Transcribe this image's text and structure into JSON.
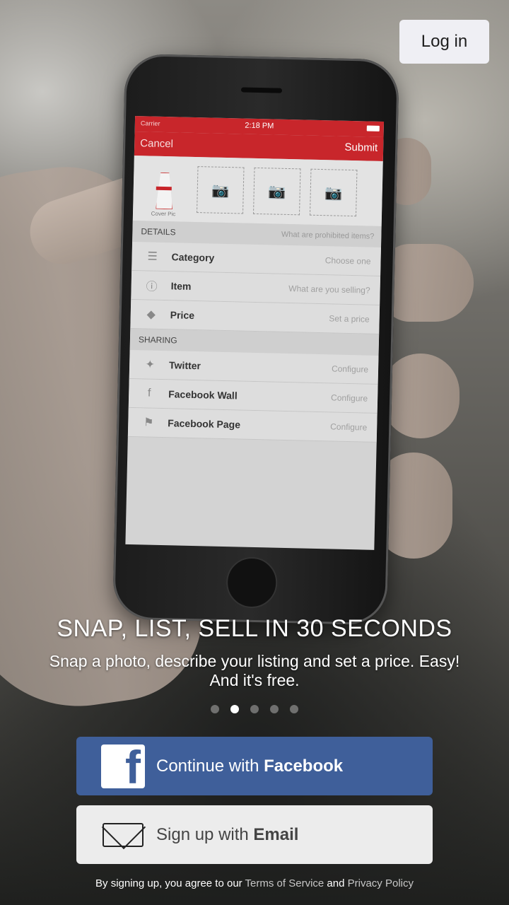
{
  "header": {
    "login_label": "Log in"
  },
  "phone_screen": {
    "status": {
      "carrier": "Carrier",
      "time": "2:18 PM"
    },
    "nav": {
      "cancel": "Cancel",
      "submit": "Submit"
    },
    "cover_label": "Cover Pic",
    "details": {
      "title": "DETAILS",
      "hint": "What are prohibited items?",
      "rows": [
        {
          "icon": "list-icon",
          "label": "Category",
          "value": "Choose one"
        },
        {
          "icon": "info-icon",
          "label": "Item",
          "value": "What are you selling?"
        },
        {
          "icon": "tag-icon",
          "label": "Price",
          "value": "Set a price"
        }
      ]
    },
    "sharing": {
      "title": "SHARING",
      "rows": [
        {
          "icon": "twitter-icon",
          "label": "Twitter",
          "value": "Configure"
        },
        {
          "icon": "facebook-icon",
          "label": "Facebook Wall",
          "value": "Configure"
        },
        {
          "icon": "flag-icon",
          "label": "Facebook Page",
          "value": "Configure"
        }
      ]
    }
  },
  "onboarding": {
    "headline": "SNAP, LIST, SELL IN 30 SECONDS",
    "subtitle_line1": "Snap a photo, describe your listing and set a price. Easy!",
    "subtitle_line2": "And it's free.",
    "page_count": 5,
    "active_page": 2
  },
  "facebook_button": {
    "prefix": "Continue with ",
    "bold": "Facebook",
    "color": "#3f5f9a"
  },
  "email_button": {
    "prefix": "Sign up with ",
    "bold": "Email"
  },
  "legal": {
    "prefix": "By signing up, you agree to our ",
    "terms": "Terms of Service",
    "and": " and ",
    "privacy": "Privacy Policy"
  }
}
